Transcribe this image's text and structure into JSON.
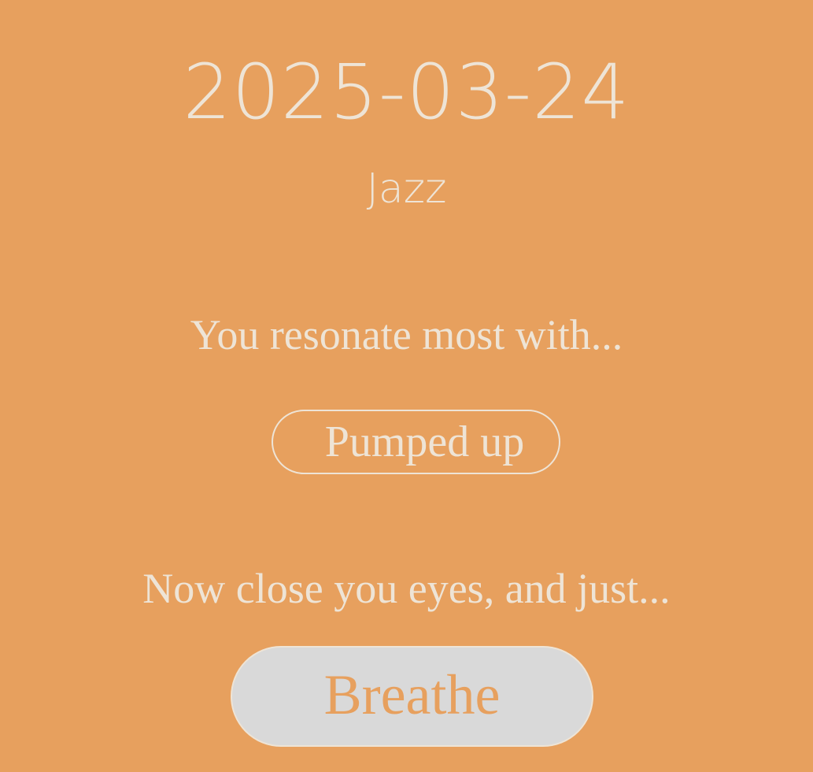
{
  "header": {
    "date": "2025-03-24",
    "genre": "Jazz"
  },
  "result": {
    "prompt": "You resonate most with...",
    "mood": "Pumped up"
  },
  "action": {
    "prompt": "Now close you eyes, and just...",
    "button_label": "Breathe"
  },
  "colors": {
    "background": "#E7A05E",
    "text": "#EEE4D6",
    "button_fill": "#D9D9D9"
  }
}
